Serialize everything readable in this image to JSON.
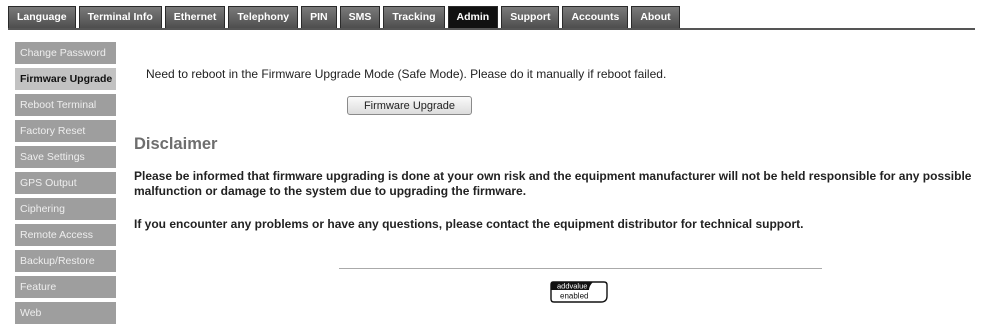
{
  "tabs": [
    {
      "label": "Language"
    },
    {
      "label": "Terminal Info"
    },
    {
      "label": "Ethernet"
    },
    {
      "label": "Telephony"
    },
    {
      "label": "PIN"
    },
    {
      "label": "SMS"
    },
    {
      "label": "Tracking"
    },
    {
      "label": "Admin",
      "active": true
    },
    {
      "label": "Support"
    },
    {
      "label": "Accounts"
    },
    {
      "label": "About"
    }
  ],
  "sidebar": {
    "items": [
      {
        "label": "Change Password"
      },
      {
        "label": "Firmware Upgrade",
        "active": true
      },
      {
        "label": "Reboot Terminal"
      },
      {
        "label": "Factory Reset"
      },
      {
        "label": "Save Settings"
      },
      {
        "label": "GPS Output"
      },
      {
        "label": "Ciphering"
      },
      {
        "label": "Remote Access"
      },
      {
        "label": "Backup/Restore"
      },
      {
        "label": "Feature"
      },
      {
        "label": "Web"
      }
    ]
  },
  "main": {
    "message": "Need to reboot in the Firmware Upgrade Mode (Safe Mode). Please do it manually if reboot failed.",
    "button_label": "Firmware Upgrade",
    "disclaimer_title": "Disclaimer",
    "disclaimer_p1": "Please be informed that firmware upgrading is done at your own risk and the equipment manufacturer will not be held responsible for any possible malfunction or damage to the system due to upgrading the firmware.",
    "disclaimer_p2": "If you encounter any problems or have any questions, please contact the equipment distributor for technical support."
  },
  "logo": {
    "line1": "addvalue",
    "line2": "enabled"
  }
}
